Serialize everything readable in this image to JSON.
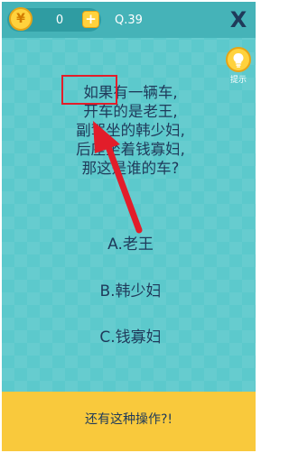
{
  "header": {
    "coin_symbol": "¥",
    "coin_count": "0",
    "add_symbol": "+",
    "question_number": "Q.39",
    "close_symbol": "X"
  },
  "hint": {
    "label": "提示"
  },
  "question": {
    "lines": [
      "如果有一辆车,",
      "开车的是老王,",
      "副驾坐的韩少妇,",
      "后座坐着钱寡妇,",
      "那这是谁的车?"
    ]
  },
  "options": [
    {
      "label": "A.老王"
    },
    {
      "label": "B.韩少妇"
    },
    {
      "label": "C.钱寡妇"
    }
  ],
  "footer": {
    "label": "还有这种操作?!"
  },
  "colors": {
    "background": "#5cc9cc",
    "topbar": "#45b3b8",
    "text": "#1f3a5a",
    "coin": "#ffd23d",
    "footer": "#f9c93c",
    "annotation": "#e21d2a"
  }
}
